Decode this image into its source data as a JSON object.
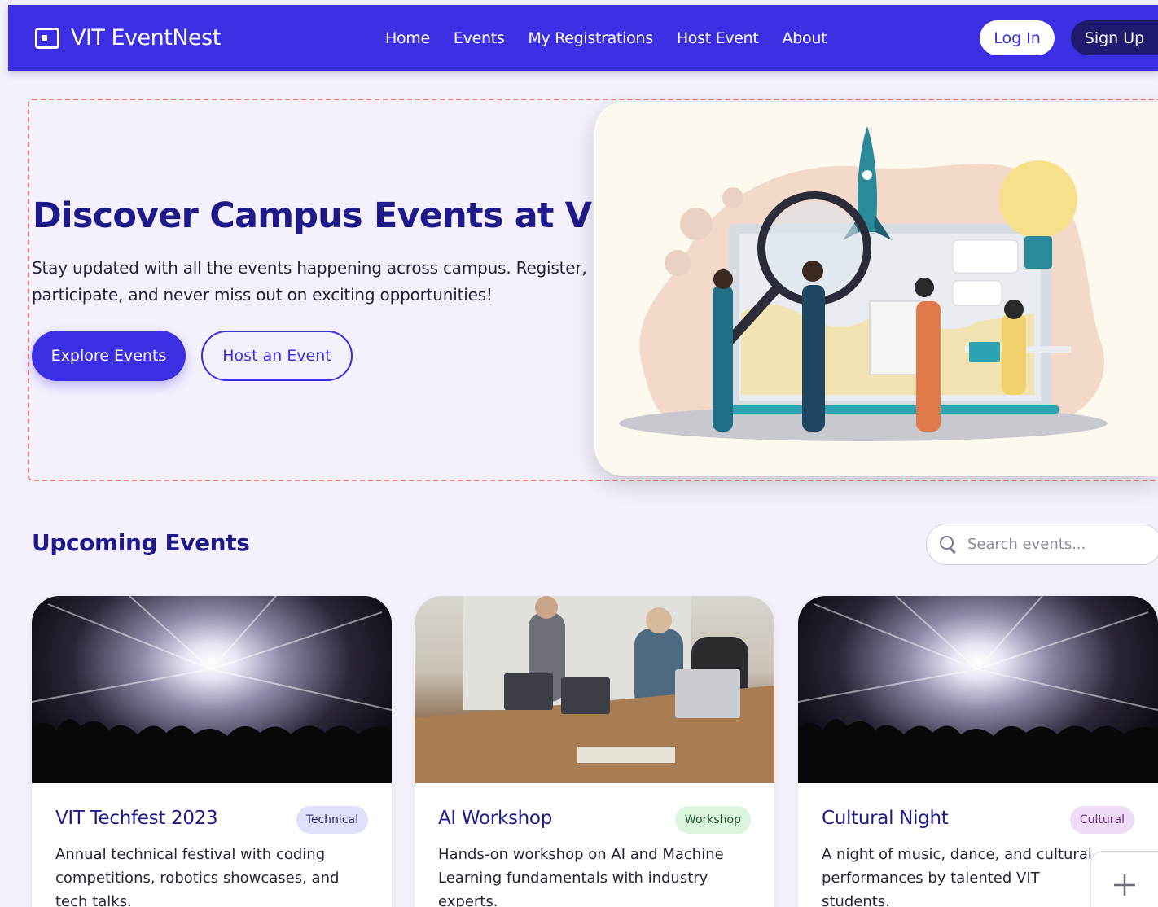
{
  "nav": {
    "brand": "VIT EventNest",
    "links": [
      "Home",
      "Events",
      "My Registrations",
      "Host Event",
      "About"
    ],
    "login": "Log In",
    "signup": "Sign Up"
  },
  "hero": {
    "title": "Discover Campus Events at VIT",
    "subtitle": "Stay updated with all the events happening across campus. Register, participate, and never miss out on exciting opportunities!",
    "explore_button": "Explore Events",
    "host_button": "Host an Event"
  },
  "events_section": {
    "title": "Upcoming Events",
    "search_placeholder": "Search events..."
  },
  "events": [
    {
      "title": "VIT Techfest 2023",
      "category": "Technical",
      "description": "Annual technical festival with coding competitions, robotics showcases, and tech talks."
    },
    {
      "title": "AI Workshop",
      "category": "Workshop",
      "description": "Hands-on workshop on AI and Machine Learning fundamentals with industry experts."
    },
    {
      "title": "Cultural Night",
      "category": "Cultural",
      "description": "A night of music, dance, and cultural performances by talented VIT students."
    }
  ],
  "colors": {
    "primary": "#3b2ee3",
    "dark_navy": "#1e1a6e",
    "heading": "#1f1a8a",
    "technical_badge": "#dfe0fb",
    "workshop_badge": "#dcf5df",
    "cultural_badge": "#efdcf7"
  }
}
